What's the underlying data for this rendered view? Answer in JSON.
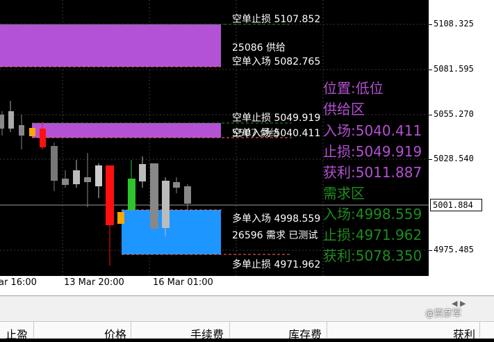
{
  "price_scale": {
    "ticks": [
      "5108.325",
      "5081.595",
      "5055.270",
      "5028.540",
      "4975.485"
    ],
    "current_price": "5001.884"
  },
  "time_axis": {
    "labels": [
      "ar 16:00",
      "13 Mar 20:00",
      "16 Mar 01:00"
    ]
  },
  "zones": {
    "supply_top": {
      "stop_label": "空单止损 5107.852",
      "mid_label": "25086 供给",
      "entry_label": "空单入场 5082.765"
    },
    "supply_current": {
      "stop_label": "空单止损 5049.919",
      "entry_label": "空单入场 5040.411",
      "overlap_label": "5507 供给"
    },
    "demand": {
      "entry_label": "多单入场 4998.559",
      "mid_label": "26596 需求 已测试",
      "stop_label": "多单止损 4971.962"
    }
  },
  "info_panel": {
    "position": "位置:低位",
    "supply_title": "供给区",
    "supply_entry": "入场:5040.411",
    "supply_stop": "止损:5049.919",
    "supply_profit": "获利:5011.887",
    "demand_title": "需求区",
    "demand_entry": "入场:4998.559",
    "demand_stop": "止损:4971.962",
    "demand_profit": "获利:5078.350",
    "supply_color": "#b450d2",
    "demand_color": "#1e8c1e"
  },
  "toolbox": {
    "columns": [
      "止盈",
      "价格",
      "手续费",
      "库存费",
      "获利"
    ]
  },
  "watermark": "@贾彦军",
  "colors": {
    "supply_zone": "#b452d6",
    "demand_zone": "#1e96ff",
    "bull_candle": "#2ec42e",
    "bear_candle": "#ff1010",
    "orange_candle": "#ffa500"
  }
}
